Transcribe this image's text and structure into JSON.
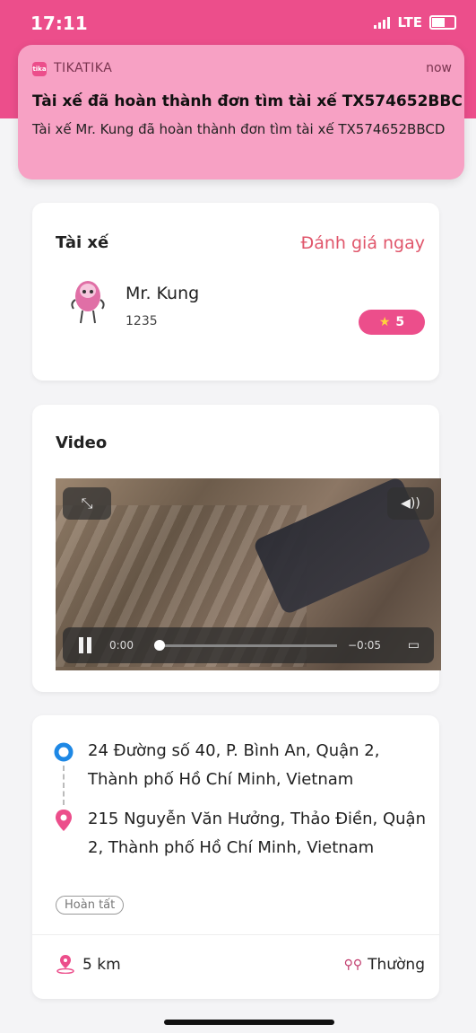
{
  "status_bar": {
    "time": "17:11",
    "network": "LTE"
  },
  "notification": {
    "app_icon_text": "tika",
    "app_name": "TIKATIKA",
    "when": "now",
    "title": "Tài xế đã hoàn thành đơn tìm tài xế TX574652BBC...",
    "body": "Tài xế Mr. Kung đã hoàn thành đơn tìm tài xế TX574652BBCD"
  },
  "driver_card": {
    "heading": "Tài xế",
    "rate_link": "Đánh giá ngay",
    "driver_name": "Mr. Kung",
    "driver_id": "1235",
    "rating": "5"
  },
  "video_card": {
    "heading": "Video",
    "current_time": "0:00",
    "remaining_time": "−0:05",
    "progress": 0
  },
  "trip_card": {
    "origin": "24 Đường số 40, P. Bình An, Quận 2, Thành phố Hồ Chí Minh, Vietnam",
    "destination": "215 Nguyễn Văn Hưởng, Thảo Điền, Quận 2, Thành phố Hồ Chí Minh, Vietnam",
    "status": "Hoàn tất",
    "distance": "5 km",
    "vehicle_type": "Thường"
  },
  "colors": {
    "brand_pink": "#ec4e8b",
    "link_red": "#e0566b",
    "origin_blue": "#1e88e5"
  },
  "icons": [
    "signal-icon",
    "battery-icon",
    "star-icon",
    "expand-icon",
    "volume-icon",
    "pause-icon",
    "airplay-icon",
    "origin-pin-icon",
    "destination-pin-icon",
    "distance-icon",
    "motorbike-icon"
  ]
}
